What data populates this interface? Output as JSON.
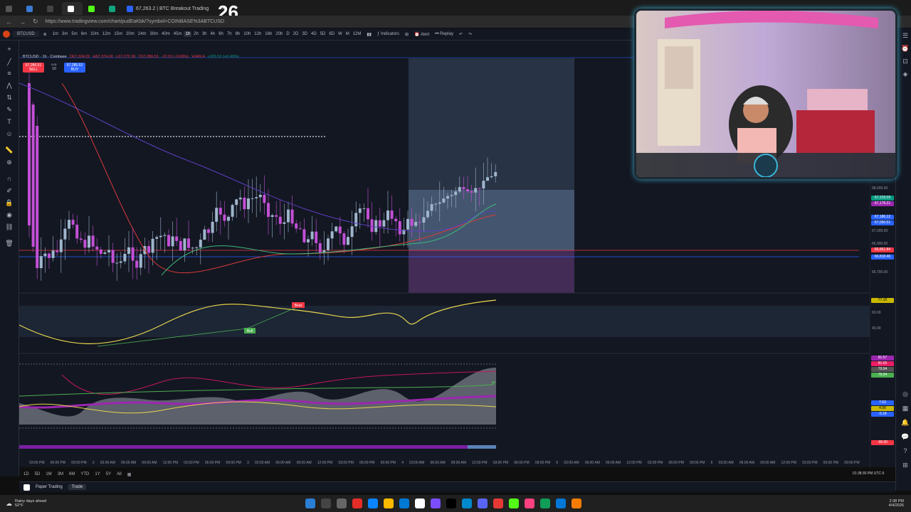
{
  "browser": {
    "tabs": [
      {
        "label": ""
      },
      {
        "label": ""
      },
      {
        "label": ""
      },
      {
        "label": ""
      },
      {
        "label": ""
      },
      {
        "label": "67,263.2 | BTC Breakout Trading"
      }
    ],
    "url": "https://www.tradingview.com/chart/pudEaKbk/?symbol=COINBASE%3ABTCUSD",
    "new_tab": "+",
    "overlay_number": "26"
  },
  "toolbar": {
    "symbol": "BTCUSD",
    "intervals": [
      "1m",
      "3m",
      "5m",
      "6m",
      "10m",
      "12m",
      "15m",
      "20m",
      "24m",
      "30m",
      "40m",
      "45m",
      "1h",
      "2h",
      "3h",
      "4h",
      "6h",
      "7h",
      "8h",
      "10h",
      "12h",
      "16h",
      "20h",
      "D",
      "2D",
      "3D",
      "4D",
      "5D",
      "6D",
      "W",
      "M",
      "12M"
    ],
    "active_interval": "1h",
    "indicators_label": "Indicators",
    "alert_label": "Alert",
    "replay_label": "Replay"
  },
  "legend": {
    "title": "BTCUSD · 1h · Coinbase",
    "open": "O67,324.02",
    "high": "H67,374.00",
    "low": "L67,272.95",
    "close": "C67,286.51",
    "change": "-37.51 (-0.06%)",
    "volume": "Vol49.4",
    "vol_change": "+326.52 (+0.49%)"
  },
  "order_panel": {
    "sell_price": "67,286.51",
    "sell_label": "SELL",
    "qty": "10",
    "spread": "0.01",
    "buy_price": "67,285.52",
    "buy_label": "BUY"
  },
  "price_axis": {
    "ticks": [
      "68,000.00",
      "67,000.00",
      "66,900.00",
      "66,700.00"
    ],
    "labels": [
      {
        "text": "67,229.09",
        "color": "#089981"
      },
      {
        "text": "67,178.21",
        "color": "#9c27b0"
      },
      {
        "text": "67,186.12",
        "color": "#2962ff"
      },
      {
        "text": "67,050.51",
        "color": "#2962ff"
      },
      {
        "text": "66,861.84",
        "color": "#f23645"
      },
      {
        "text": "66,818.46",
        "color": "#2962ff"
      }
    ]
  },
  "rsi_pane": {
    "bear_label": "Bear",
    "bull_label": "Bull",
    "ticks": [
      "77.15",
      "60.00",
      "40.00"
    ]
  },
  "osc_pane": {
    "ticks": [
      "81.57",
      "81.65",
      "79.94",
      "75.04",
      "7.63",
      "4.90",
      "-5.18",
      "-90.00"
    ]
  },
  "time_axis": {
    "labels": [
      "03:00 PM",
      "06:00 PM",
      "09:00 PM",
      "2",
      "03:00 AM",
      "06:00 AM",
      "09:00 AM",
      "12:00 PM",
      "03:00 PM",
      "06:00 PM",
      "09:00 PM",
      "3",
      "03:00 AM",
      "06:00 AM",
      "09:00 AM",
      "12:00 PM",
      "03:00 PM",
      "06:00 PM",
      "09:00 PM",
      "4",
      "03:00 AM",
      "06:00 AM",
      "09:00 AM",
      "12:00 PM",
      "03:00 PM",
      "06:00 PM",
      "09:00 PM",
      "5",
      "03:00 AM",
      "06:00 AM",
      "09:00 AM",
      "12:00 PM",
      "03:00 PM",
      "06:00 PM",
      "09:00 PM",
      "6",
      "03:00 AM",
      "06:00 AM",
      "09:00 AM",
      "12:00 PM",
      "03:00 PM",
      "06:00 PM",
      "09:00 PM"
    ],
    "clock": "01:38:30 PM UTC-5"
  },
  "ranges": [
    "1D",
    "5D",
    "1M",
    "3M",
    "6M",
    "YTD",
    "1Y",
    "5Y",
    "All"
  ],
  "bottom_panel": {
    "paper_trading": "Paper Trading",
    "trade": "Trade"
  },
  "taskbar": {
    "weather": "Rainy days ahead",
    "temp": "52°F",
    "time": "2:38 PM",
    "date": "4/4/2026"
  },
  "colors": {
    "bg": "#131722",
    "up": "#9fb5cc",
    "down": "#c34fd6",
    "accent": "#2962ff"
  }
}
